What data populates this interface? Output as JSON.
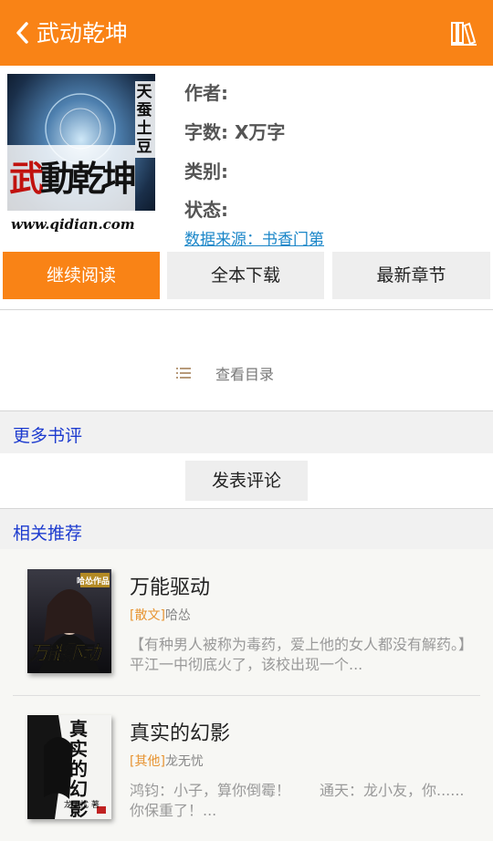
{
  "header": {
    "title": "武动乾坤",
    "back_icon": "chevron-left-icon",
    "shelf_icon": "bookshelf-icon",
    "bg_color": "#f98316"
  },
  "book": {
    "cover": {
      "title_chars": [
        "武",
        "動",
        "乾",
        "坤"
      ],
      "side_text": [
        "天",
        "蚕",
        "土",
        "豆"
      ],
      "url_text": "www.qidian.com"
    },
    "author_label": "作者:",
    "words_label": "字数: X万字",
    "category_label": "类别:",
    "status_label": "状态:",
    "source_link": "数据来源：书香门第"
  },
  "actions": {
    "continue": "继续阅读",
    "download": "全本下载",
    "latest": "最新章节"
  },
  "toc": {
    "icon": "list-icon",
    "label": "查看目录"
  },
  "reviews": {
    "heading": "更多书评",
    "post_button": "发表评论"
  },
  "recommend": {
    "heading": "相关推荐",
    "items": [
      {
        "title": "万能驱动",
        "category": "[散文]",
        "author": "哈怂",
        "desc": "【有种男人被称为毒药，爱上他的女人都没有解药。】　　平江一中彻底火了，该校出现一个...",
        "cover_title": "万能驱动",
        "cover_badge": "哈怂作品"
      },
      {
        "title": "真实的幻影",
        "category": "[其他]",
        "author": "龙无忧",
        "desc": "鸿钧：小子，算你倒霉！　　通天：龙小友，你......你保重了！...",
        "cover_title": "真实的幻影",
        "cover_author": "龙无忧 著"
      }
    ]
  }
}
